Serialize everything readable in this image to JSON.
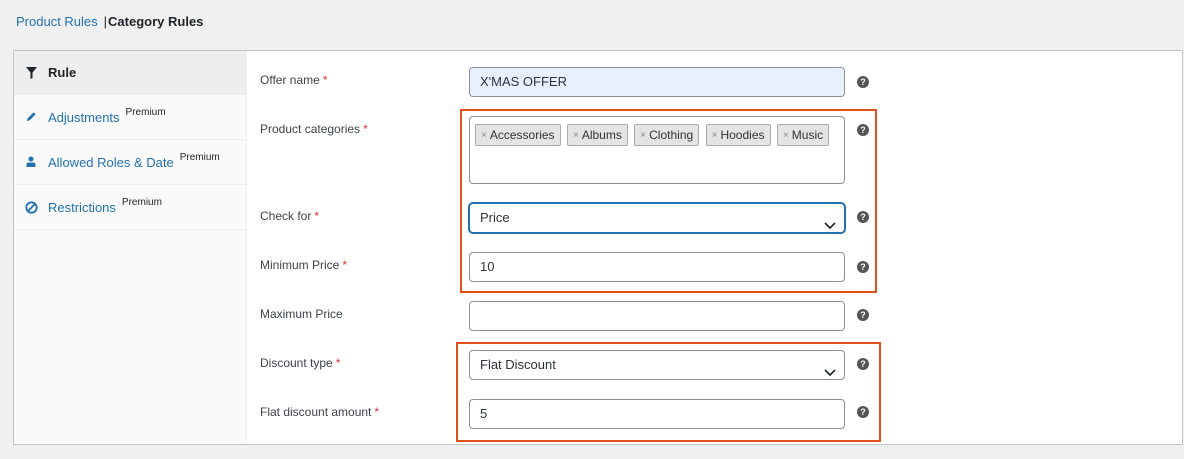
{
  "top_links": {
    "product_rules": "Product Rules",
    "separator": "|",
    "category_rules": "Category Rules"
  },
  "sidebar": {
    "items": [
      {
        "label": "Rule",
        "icon": "filter-icon",
        "badge": "",
        "active": true
      },
      {
        "label": "Adjustments",
        "icon": "pencil-icon",
        "badge": "Premium",
        "active": false
      },
      {
        "label": "Allowed Roles & Date",
        "icon": "user-icon",
        "badge": "Premium",
        "active": false
      },
      {
        "label": "Restrictions",
        "icon": "ban-icon",
        "badge": "Premium",
        "active": false
      }
    ]
  },
  "form": {
    "required_mark": "*",
    "help_glyph": "?",
    "offer_name": {
      "label": "Offer name",
      "value": "X'MAS OFFER"
    },
    "product_categories": {
      "label": "Product categories",
      "chip_remove": "×",
      "chips": [
        "Accessories",
        "Albums",
        "Clothing",
        "Hoodies",
        "Music"
      ]
    },
    "check_for": {
      "label": "Check for",
      "value": "Price"
    },
    "minimum_price": {
      "label": "Minimum Price",
      "value": "10"
    },
    "maximum_price": {
      "label": "Maximum Price",
      "value": ""
    },
    "discount_type": {
      "label": "Discount type",
      "value": "Flat Discount"
    },
    "flat_discount_amount": {
      "label": "Flat discount amount",
      "value": "5"
    }
  },
  "colors": {
    "link": "#2271b1",
    "highlight_border": "#e2501c",
    "required": "#d63638",
    "autofill": "#e8f0fe"
  }
}
